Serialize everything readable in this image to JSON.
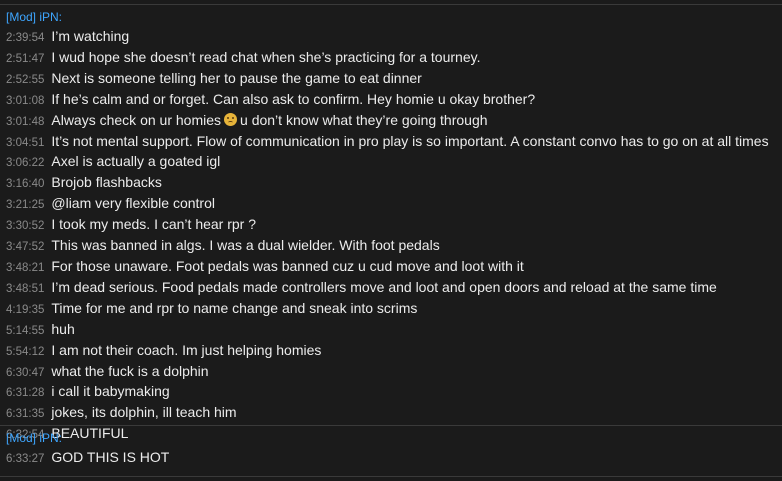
{
  "groups": [
    {
      "author": "[Mod] iPN:",
      "messages": [
        {
          "time": "2:39:54",
          "text": "I’m watching"
        },
        {
          "time": "2:51:47",
          "text": "I wud hope she doesn’t read chat when she’s practicing for a tourney."
        },
        {
          "time": "2:52:55",
          "text": "Next is someone telling her to pause the game to eat dinner"
        },
        {
          "time": "3:01:08",
          "text": "If he’s calm and or forget. Can also ask to confirm. Hey homie u okay brother?"
        },
        {
          "time": "3:01:48",
          "text_before": "Always check on ur homies",
          "emoji": "pensive-face-emoji",
          "text_after": "u don’t know what they’re going through"
        },
        {
          "time": "3:04:51",
          "text": "It’s not mental support. Flow of communication in pro play is so important. A constant convo has to go on at all times"
        },
        {
          "time": "3:06:22",
          "text": "Axel is actually a goated igl"
        },
        {
          "time": "3:16:40",
          "text": "Brojob flashbacks"
        },
        {
          "time": "3:21:25",
          "text": "@liam very flexible control"
        },
        {
          "time": "3:30:52",
          "text": "I took my meds. I can’t hear rpr ?"
        },
        {
          "time": "3:47:52",
          "text": "This was banned in algs. I was a dual wielder. With foot pedals"
        },
        {
          "time": "3:48:21",
          "text": "For those unaware. Foot pedals was banned cuz u cud move and loot with it"
        },
        {
          "time": "3:48:51",
          "text": "I’m dead serious. Food pedals made controllers move and loot and open doors and reload at the same time"
        },
        {
          "time": "4:19:35",
          "text": "Time for me and rpr to name change and sneak into scrims"
        },
        {
          "time": "5:14:55",
          "text": "huh"
        },
        {
          "time": "5:54:12",
          "text": "I am not their coach. Im just helping homies"
        },
        {
          "time": "6:30:47",
          "text": "what the fuck is a dolphin"
        },
        {
          "time": "6:31:28",
          "text": "i call it babymaking"
        },
        {
          "time": "6:31:35",
          "text": "jokes, its dolphin, ill teach him"
        },
        {
          "time": "6:32:54",
          "text": "BEAUTIFUL"
        }
      ]
    },
    {
      "author": "[Mod] iPN:",
      "messages": [
        {
          "time": "6:33:27",
          "text": "GOD THIS IS HOT"
        }
      ]
    }
  ],
  "colors": {
    "background": "#1b1b1b",
    "author": "#3ea6ff",
    "timestamp": "#8a8a8a",
    "text": "#ececec"
  }
}
